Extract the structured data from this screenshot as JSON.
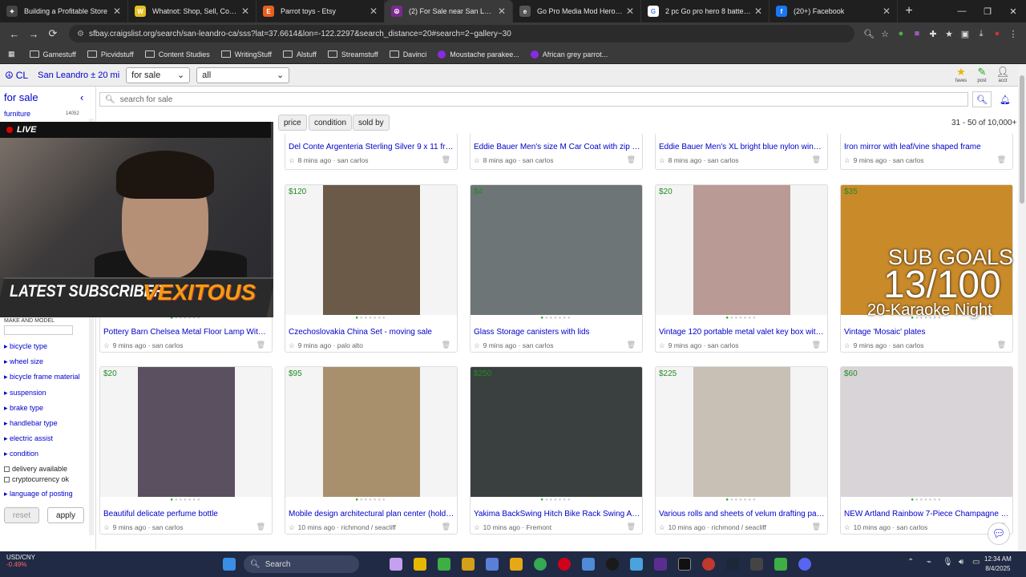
{
  "tabs": [
    {
      "title": "Building a Profitable Store",
      "icon": "sparkle-icon",
      "color": "#444444",
      "letter": "✦"
    },
    {
      "title": "Whatnot: Shop, Sell, Connect",
      "icon": "whatnot-icon",
      "color": "#e6c020",
      "letter": "W"
    },
    {
      "title": "Parrot toys - Etsy",
      "icon": "etsy-icon",
      "color": "#e8601c",
      "letter": "E"
    },
    {
      "title": "(2) For Sale near San Leandro, C",
      "icon": "craigslist-icon",
      "color": "#7b2b8f",
      "letter": "☮"
    },
    {
      "title": "Go Pro Media Mod Hero 8 for s",
      "icon": "ebay-icon",
      "color": "#555555",
      "letter": "e"
    },
    {
      "title": "2 pc Go pro hero 8 battery doo",
      "icon": "google-icon",
      "color": "#ffffff",
      "letter": "G"
    },
    {
      "title": "(20+) Facebook",
      "icon": "facebook-icon",
      "color": "#1877f2",
      "letter": "f"
    }
  ],
  "url": "sfbay.craigslist.org/search/san-leandro-ca/sss?lat=37.6614&lon=-122.2297&search_distance=20#search=2~gallery~30",
  "bookmarks": [
    {
      "label": "Gamestuff",
      "type": "folder"
    },
    {
      "label": "Picvidstuff",
      "type": "folder"
    },
    {
      "label": "Content Studies",
      "type": "folder"
    },
    {
      "label": "WritingStuff",
      "type": "folder"
    },
    {
      "label": "Alstuff",
      "type": "folder"
    },
    {
      "label": "Streamstuff",
      "type": "folder"
    },
    {
      "label": "Davinci",
      "type": "folder"
    },
    {
      "label": "Moustache parakee...",
      "type": "site"
    },
    {
      "label": "African grey parrot...",
      "type": "site"
    }
  ],
  "header": {
    "cl": "CL",
    "location": "San Leandro ± 20 mi",
    "category": "for sale",
    "subcategory": "all",
    "faves": "faves",
    "post": "post",
    "acct": "acct"
  },
  "sidebar": {
    "title": "for sale",
    "furniture": "furniture",
    "furniture_count": "14052",
    "make_model": "MAKE AND MODEL",
    "facets": [
      "bicycle type",
      "wheel size",
      "bicycle frame material",
      "suspension",
      "brake type",
      "handlebar type",
      "electric assist",
      "condition"
    ],
    "checks": [
      "delivery available",
      "cryptocurrency ok"
    ],
    "language": "language of posting",
    "reset": "reset",
    "apply": "apply"
  },
  "search": {
    "placeholder": "search for sale"
  },
  "filters": {
    "price": "price",
    "condition": "condition",
    "sold_by": "sold by"
  },
  "range": "31 - 50 of 10,000+",
  "listings_row0": [
    {
      "title": "Del Conte Argenteria Sterling Silver 9 x 11 frame",
      "meta": "8 mins ago · san carlos"
    },
    {
      "title": "Eddie Bauer Men's size M Car Coat with zip o...",
      "meta": "8 mins ago · san carlos"
    },
    {
      "title": "Eddie Bauer Men's XL bright blue nylon windb...",
      "meta": "8 mins ago · san carlos"
    },
    {
      "title": "Iron mirror with leaf/vine shaped frame",
      "meta": "9 mins ago · san carlos"
    }
  ],
  "listings_row1": [
    {
      "price": "",
      "title": "Pottery Barn Chelsea Metal Floor Lamp With ...",
      "meta": "9 mins ago · san carlos",
      "color": "#8a8070"
    },
    {
      "price": "$120",
      "title": "Czechoslovakia China Set - moving sale",
      "meta": "9 mins ago · palo alto",
      "color": "#6b5a48"
    },
    {
      "price": "$4",
      "title": "Glass Storage canisters with lids",
      "meta": "9 mins ago · san carlos",
      "color": "#6e7576"
    },
    {
      "price": "$20",
      "title": "Vintage 120 portable metal valet key box with l...",
      "meta": "9 mins ago · san carlos",
      "color": "#b99a94"
    },
    {
      "price": "$35",
      "title": "Vintage 'Mosaic' plates",
      "meta": "9 mins ago · san carlos",
      "color": "#c98a2a"
    }
  ],
  "listings_row2": [
    {
      "price": "$20",
      "title": "Beautiful delicate perfume bottle",
      "meta": "9 mins ago · san carlos",
      "color": "#5a5060"
    },
    {
      "price": "$95",
      "title": "Mobile design architectural plan center (holder...",
      "meta": "10 mins ago · richmond / seacliff",
      "color": "#a8906c"
    },
    {
      "price": "$250",
      "title": "Yakima BackSwing Hitch Bike Rack Swing Ad...",
      "meta": "10 mins ago · Fremont",
      "color": "#3a4040"
    },
    {
      "price": "$225",
      "title": "Various rolls and sheets of velum drafting pap...",
      "meta": "10 mins ago · richmond / seacliff",
      "color": "#c8c0b4"
    },
    {
      "price": "$60",
      "title": "NEW Artland Rainbow 7-Piece Champagne Fl...",
      "meta": "10 mins ago · san carlos",
      "color": "#d8d4d8"
    }
  ],
  "overlay": {
    "live": "LIVE",
    "latest": "LATEST SUBSCRIBER",
    "name": "VEXITOUS",
    "goal_title": "SUB GOALS",
    "goal_count": "13/100",
    "goal_reward": "20-Karaoke Night"
  },
  "taskbar": {
    "ticker": "USD/CNY",
    "ticker_change": "-0.49%",
    "search": "Search",
    "time": "12:34 AM",
    "date": "8/4/2025"
  }
}
